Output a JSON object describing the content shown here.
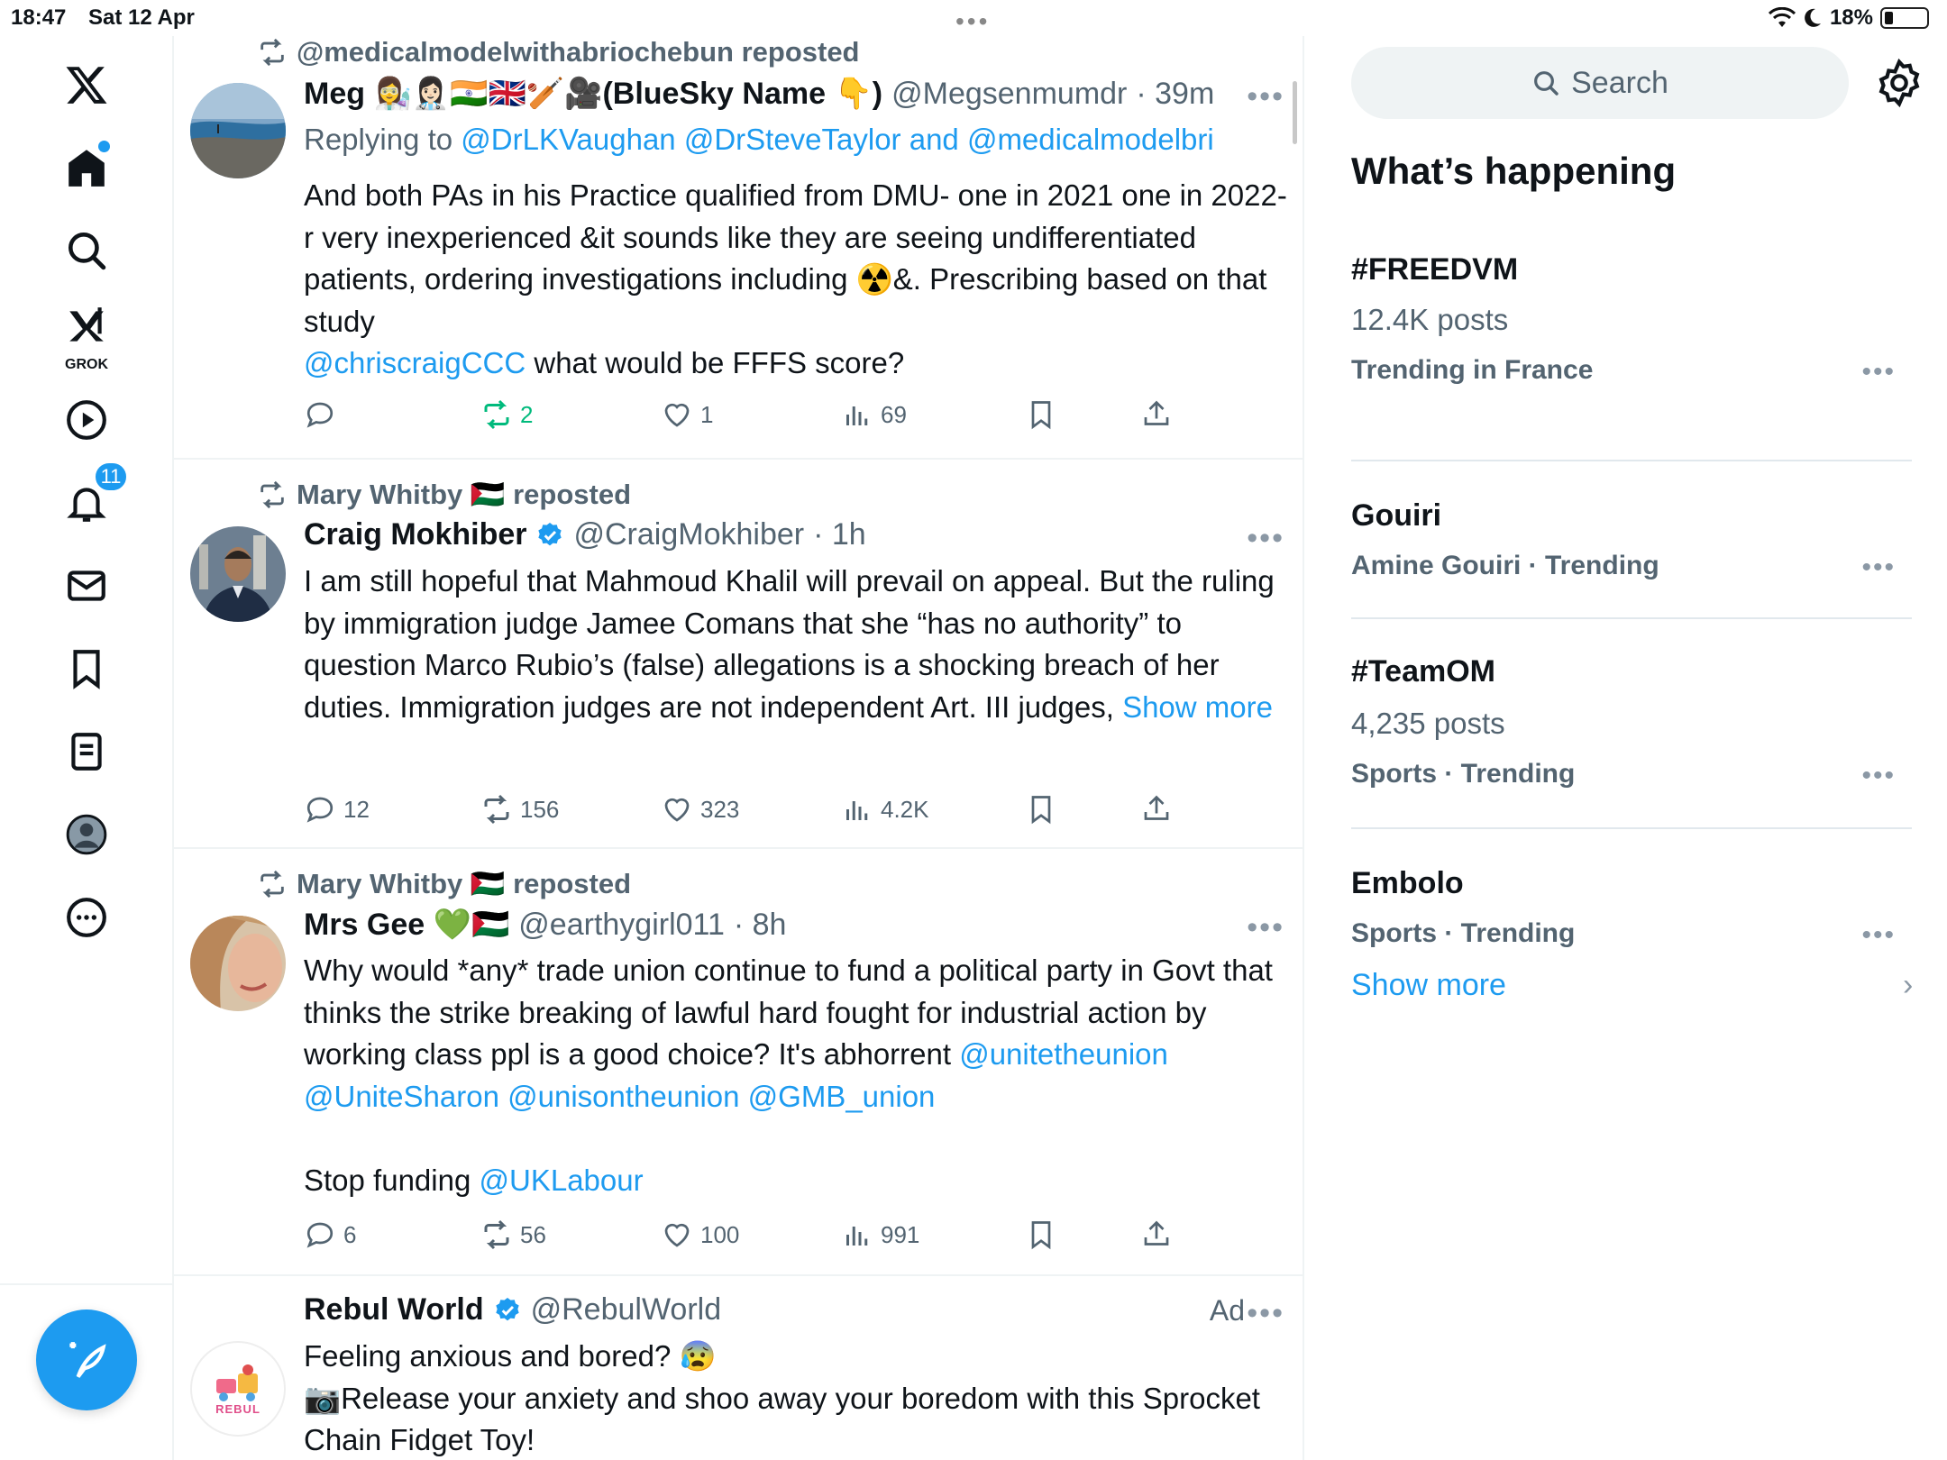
{
  "status": {
    "time": "18:47",
    "date": "Sat 12 Apr",
    "battery": "18%",
    "battery_level": 0.18
  },
  "nav": {
    "items": [
      "logo-x",
      "home",
      "search",
      "grok",
      "video",
      "notifications",
      "messages",
      "bookmarks",
      "lists",
      "profile",
      "more"
    ],
    "grok_label": "GROK",
    "notifications_count": "11"
  },
  "tweets": [
    {
      "repost": "@medicalmodelwithabriochebun reposted",
      "name": "Meg 👩‍🔬👩🏻‍⚕️🇮🇳🇬🇧🏏🎥(BlueSky Name 👇)",
      "handle": "@Megsenmumdr",
      "time": "· 39m",
      "replying_prefix": "Replying to",
      "replying_to": "@DrLKVaughan @DrSteveTaylor and @medicalmodelbri",
      "text_1": "And both PAs in his Practice qualified from DMU- one in 2021 one in 2022-r very inexperienced &it sounds like they are seeing undifferentiated patients, ordering investigations including ☢️&. Prescribing based on that study",
      "mention": "@chriscraigCCC",
      "text_2": " what would be FFFS score?",
      "replies": "",
      "reposts": "2",
      "likes": "1",
      "views": "69"
    },
    {
      "repost": "Mary Whitby 🇵🇸 reposted",
      "name": "Craig Mokhiber",
      "handle": "@CraigMokhiber",
      "time": "· 1h",
      "text": "I am still hopeful that Mahmoud Khalil will prevail on appeal. But the ruling by immigration judge Jamee Comans that she “has no authority” to question Marco Rubio’s (false) allegations is a shocking breach of her duties. Immigration judges are not independent Art. III judges, ",
      "show_more": "Show more",
      "replies": "12",
      "reposts": "156",
      "likes": "323",
      "views": "4.2K"
    },
    {
      "repost": "Mary Whitby 🇵🇸 reposted",
      "name": "Mrs Gee 💚🇵🇸",
      "handle": "@earthygirl011",
      "time": "· 8h",
      "text_1": "Why would *any* trade union continue to fund a political party in Govt that thinks the strike breaking of lawful hard fought for industrial action by working class ppl is a good choice? It's abhorrent ",
      "mentions_1": "@unitetheunion @UniteSharon @unisontheunion @GMB_union",
      "text_2": "Stop funding ",
      "mention_2": "@UKLabour",
      "replies": "6",
      "reposts": "56",
      "likes": "100",
      "views": "991"
    },
    {
      "name": "Rebul World",
      "handle": "@RebulWorld",
      "ad_label": "Ad",
      "avatar_text": "REBUL",
      "text_1": "Feeling anxious and bored? 😰",
      "text_2": "📷Release your anxiety and shoo away your boredom with this Sprocket Chain Fidget Toy!"
    }
  ],
  "sidebar": {
    "search_placeholder": "Search",
    "heading": "What’s happening",
    "trends": [
      {
        "title": "#FREEDVM",
        "posts": "12.4K posts",
        "meta": "Trending in France"
      },
      {
        "title": "Gouiri",
        "posts": "",
        "meta": "Amine Gouiri · Trending"
      },
      {
        "title": "#TeamOM",
        "posts": "4,235 posts",
        "meta": "Sports · Trending"
      },
      {
        "title": "Embolo",
        "posts": "",
        "meta": "Sports · Trending"
      }
    ],
    "show_more": "Show more"
  },
  "colors": {
    "accent": "#1d9bf0",
    "repost_green": "#00ba7c",
    "muted": "#536471"
  }
}
